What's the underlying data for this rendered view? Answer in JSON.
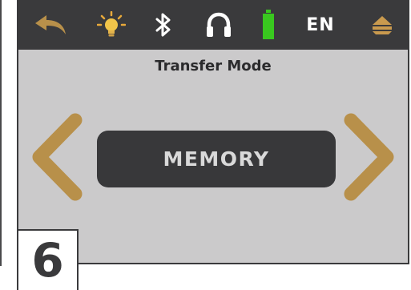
{
  "statusbar": {
    "back_icon": "back-arrow-icon",
    "brightness_icon": "lightbulb-icon",
    "bluetooth_icon": "bluetooth-icon",
    "headphones_icon": "headphones-icon",
    "battery_icon": "battery-icon",
    "battery_level": 1.0,
    "language": "EN",
    "menu_icon": "menu-eject-icon"
  },
  "screen": {
    "title": "Transfer Mode",
    "selected_mode": "MEMORY",
    "prev_icon": "chevron-left-icon",
    "next_icon": "chevron-right-icon"
  },
  "step": "6",
  "colors": {
    "accent": "#b8904a",
    "battery": "#39c81f",
    "statusbar_bg": "#3a3a3c",
    "screen_bg": "#cbcacb",
    "mode_box_bg": "#38383a"
  }
}
